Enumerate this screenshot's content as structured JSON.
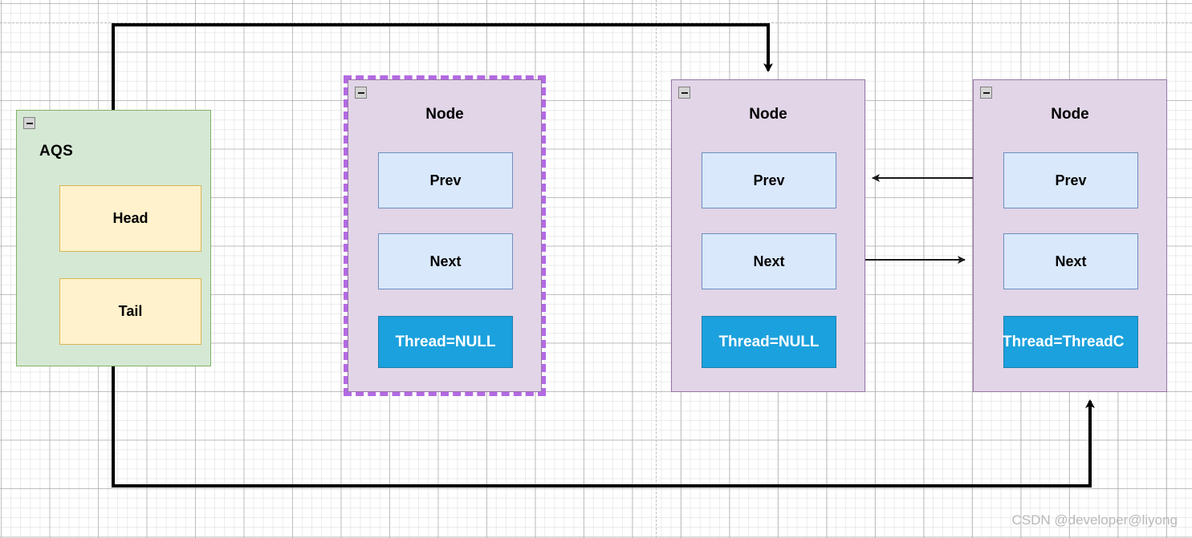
{
  "diagram": {
    "title": "AQS CLH queue node linkage",
    "watermark": "CSDN @developer@liyong",
    "colors": {
      "aqs_fill": "#d5e8d4",
      "aqs_border": "#82b366",
      "node_fill": "#e1d5e7",
      "node_border": "#9673a6",
      "field_yellow_fill": "#fff2cc",
      "field_yellow_border": "#d6b656",
      "field_blue_fill": "#dae8fc",
      "field_blue_border": "#6c8ebf",
      "thread_fill": "#1ba1dd",
      "thread_text": "#ffffff",
      "selection": "#b36ae2",
      "connector": "#000000",
      "grid": "#c8c8c8"
    }
  },
  "aqs": {
    "label": "AQS",
    "collapse_icon": "minus-square-icon",
    "fields": [
      {
        "label": "Head"
      },
      {
        "label": "Tail"
      }
    ]
  },
  "nodes": [
    {
      "title": "Node",
      "collapse_icon": "minus-square-icon",
      "selected": true,
      "prev": "Prev",
      "next": "Next",
      "thread": "Thread=NULL",
      "thread_overflow": false
    },
    {
      "title": "Node",
      "collapse_icon": "minus-square-icon",
      "selected": false,
      "prev": "Prev",
      "next": "Next",
      "thread": "Thread=NULL",
      "thread_overflow": false
    },
    {
      "title": "Node",
      "collapse_icon": "minus-square-icon",
      "selected": false,
      "prev": "Prev",
      "next": "Next",
      "thread": "Thread=ThreadC",
      "thread_overflow": true
    }
  ],
  "connectors": [
    {
      "name": "head-to-node2",
      "from": "AQS.Head",
      "to": "Node2.top",
      "style": "thick-orthogonal",
      "arrow": "end"
    },
    {
      "name": "tail-to-node3",
      "from": "AQS.Tail",
      "to": "Node3.bottom",
      "style": "thick-orthogonal",
      "arrow": "end"
    },
    {
      "name": "node3-prev-to-node2",
      "from": "Node3.Prev",
      "to": "Node2.Prev",
      "style": "thin-straight",
      "arrow": "end-left"
    },
    {
      "name": "node2-next-to-node3",
      "from": "Node2.Next",
      "to": "Node3.Next",
      "style": "thin-straight",
      "arrow": "end-right"
    }
  ]
}
